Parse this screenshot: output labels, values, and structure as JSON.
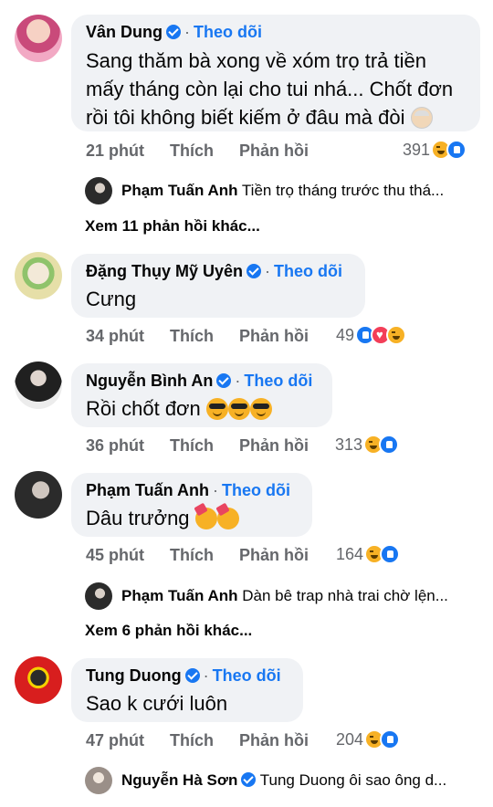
{
  "labels": {
    "follow": "Theo dõi",
    "like": "Thích",
    "reply": "Phản hồi",
    "dot": "·"
  },
  "comments": [
    {
      "name": "Vân Dung",
      "text": "Sang thăm bà xong về xóm trọ trả tiền mấy tháng còn lại cho tui nhá... Chốt đơn rồi tôi không biết kiếm ở đâu mà đòi",
      "time": "21 phút",
      "reactions_count": "391",
      "reply_preview": {
        "name": "Phạm Tuấn Anh",
        "text": "Tiền trọ tháng trước thu thá..."
      },
      "more_replies": "Xem 11 phản hồi khác..."
    },
    {
      "name": "Đặng Thụy Mỹ Uyên",
      "text": "Cưng",
      "time": "34 phút",
      "reactions_count": "49"
    },
    {
      "name": "Nguyễn Bình An",
      "text": "Rồi chốt đơn",
      "time": "36 phút",
      "reactions_count": "313"
    },
    {
      "name": "Phạm Tuấn Anh",
      "text": "Dâu trưởng",
      "time": "45 phút",
      "reactions_count": "164",
      "reply_preview": {
        "name": "Phạm Tuấn Anh",
        "text": "Dàn bê trap nhà trai chờ lện..."
      },
      "more_replies": "Xem 6 phản hồi khác..."
    },
    {
      "name": "Tung Duong",
      "text": "Sao k cưới luôn",
      "time": "47 phút",
      "reactions_count": "204",
      "reply_preview": {
        "name": "Nguyễn Hà Sơn",
        "text": "Tung Duong ôi sao ông d..."
      }
    }
  ],
  "colors": {
    "bubble": "#f0f2f5",
    "link": "#1877f2",
    "muted": "#65676b"
  }
}
